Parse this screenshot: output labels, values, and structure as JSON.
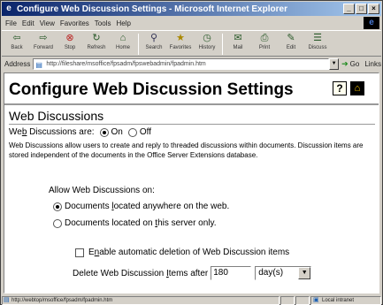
{
  "window": {
    "title": "Configure Web Discussion Settings - Microsoft Internet Explorer",
    "controls": {
      "minimize": "_",
      "maximize": "□",
      "close": "×"
    }
  },
  "menu": [
    "File",
    "Edit",
    "View",
    "Favorites",
    "Tools",
    "Help"
  ],
  "toolbar": [
    {
      "label": "Back",
      "icon": "back-arrow-icon"
    },
    {
      "label": "Forward",
      "icon": "forward-arrow-icon"
    },
    {
      "label": "Stop",
      "icon": "stop-icon"
    },
    {
      "label": "Refresh",
      "icon": "refresh-icon"
    },
    {
      "label": "Home",
      "icon": "home-icon"
    },
    {
      "label": "Search",
      "icon": "search-icon"
    },
    {
      "label": "Favorites",
      "icon": "favorites-icon"
    },
    {
      "label": "History",
      "icon": "history-icon"
    },
    {
      "label": "Mail",
      "icon": "mail-icon"
    },
    {
      "label": "Print",
      "icon": "print-icon"
    },
    {
      "label": "Edit",
      "icon": "edit-icon"
    },
    {
      "label": "Discuss",
      "icon": "discuss-icon"
    }
  ],
  "address": {
    "label": "Address",
    "value": "http://fileshare/msoffice/fpsadm/fpswebadmin/fpadmin.htm",
    "go_label": "Go",
    "links_label": "Links"
  },
  "page": {
    "title": "Configure Web Discussion Settings",
    "help_icon_text": "?",
    "section_title": "Web Discussions",
    "wd_label_pre": "We",
    "wd_label_acc": "b",
    "wd_label_post": " Discussions are:",
    "on_label": "On",
    "off_label": "Off",
    "web_discussions_on": true,
    "description": "Web Discussions allow users to create and reply to threaded discussions within documents. Discussion items are stored independent of the documents in the Office Server Extensions database.",
    "allow_label": "Allow Web Discussions on:",
    "opt1_pre": "Documents ",
    "opt1_acc": "l",
    "opt1_post": "ocated anywhere on the web.",
    "opt2_pre": "Documents located on ",
    "opt2_acc": "t",
    "opt2_post": "his server only.",
    "anywhere_selected": true,
    "autodelete_pre": "E",
    "autodelete_acc": "n",
    "autodelete_post": "able automatic deletion of Web Discussion items",
    "autodelete_checked": false,
    "delete_pre": "Delete Web Discussion ",
    "delete_acc": "I",
    "delete_post": "tems after",
    "delete_after_value": "180",
    "unit_selected": "day(s)"
  },
  "status": {
    "text": "http://webtop/msoffice/fpsadm/fpadmin.htm",
    "zone": "Local intranet"
  }
}
